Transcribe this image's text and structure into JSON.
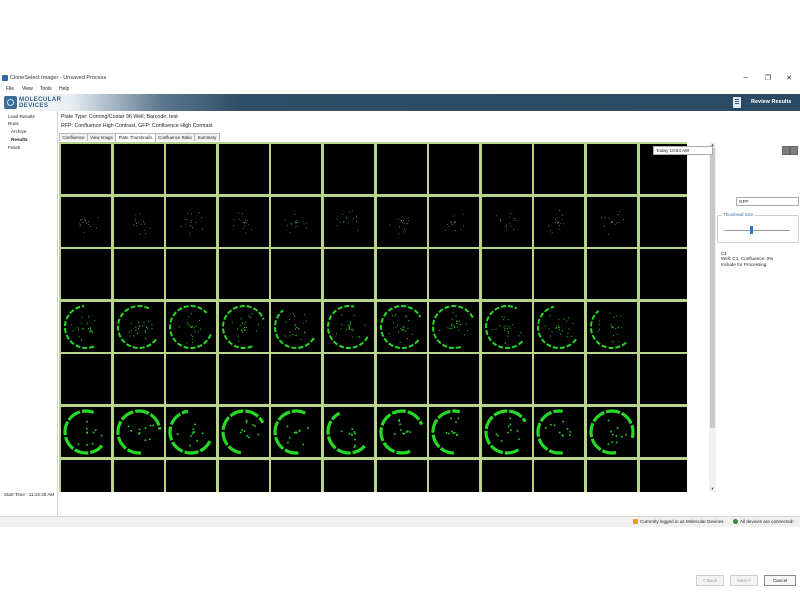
{
  "window": {
    "title": "CloneSelect Imager - Unsaved Process",
    "controls": {
      "minimize": "─",
      "maximize": "❐",
      "close": "✕"
    }
  },
  "menu": [
    "File",
    "View",
    "Tools",
    "Help"
  ],
  "banner": {
    "logo_line1": "MOLECULAR",
    "logo_line2": "DEVICES",
    "review_label": "Review Results"
  },
  "nav": {
    "items": [
      {
        "label": "Load Results",
        "active": false
      },
      {
        "label": "Runs",
        "active": false
      },
      {
        "label": "Archive",
        "active": false
      },
      {
        "label": "Results",
        "active": true
      },
      {
        "label": "Finish",
        "active": false
      }
    ],
    "start_time": "Start Time : 11:16:30 AM"
  },
  "plate": {
    "info_line1": "Plate Type: Corning/Costar 96 Well, Barcode: test",
    "info_line2": "RFP: Confluence High Contrast, GFP: Confluence High Contrast"
  },
  "tabs": [
    {
      "label": "Confluence",
      "active": false
    },
    {
      "label": "View Image",
      "active": false
    },
    {
      "label": "Plate Thumbnails",
      "active": true
    },
    {
      "label": "Confluence Ratio",
      "active": false
    },
    {
      "label": "Summary",
      "active": false
    }
  ],
  "thumbnails": {
    "columns": 12,
    "visible_rows": 7,
    "row_types": [
      "empty",
      "sparse",
      "empty",
      "ring",
      "empty",
      "bright-ring",
      "empty"
    ],
    "row_counts": [
      0,
      11,
      0,
      11,
      0,
      11,
      0
    ],
    "signal_color": "#27d827",
    "border_color": "#b7d48a"
  },
  "right": {
    "date_select": "Today 10:54 AM",
    "channel_select": "GFP",
    "thumbnail_size_label": "Thumbnail Size",
    "thumbnail_size": 0.5,
    "well_id": "C1",
    "well_line2": "Well: C1, Confluence: 0%",
    "well_line3": "Include for Processing"
  },
  "footer": {
    "back": "< Back",
    "next": "Next >",
    "cancel": "Cancel"
  },
  "status": {
    "logged_in": "Currently logged in as Molecular Devices",
    "devices": "All devices are connected!"
  }
}
